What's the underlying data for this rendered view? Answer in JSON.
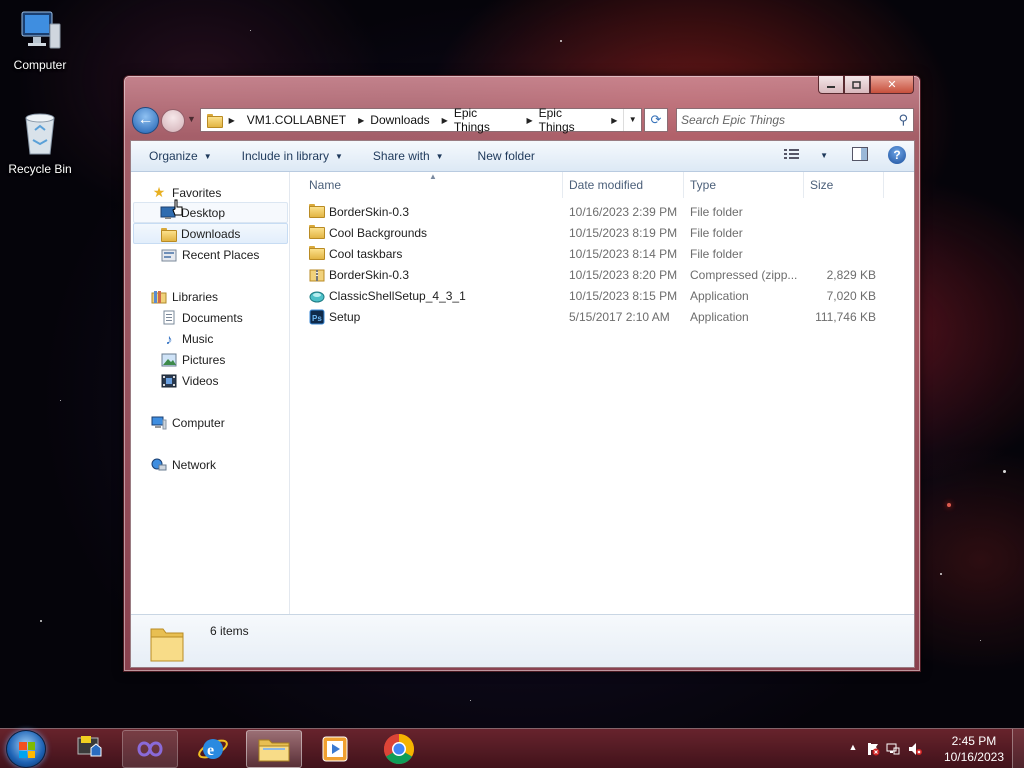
{
  "desktop": {
    "icons": [
      {
        "label": "Computer",
        "icon": "computer-icon"
      },
      {
        "label": "Recycle Bin",
        "icon": "recycle-bin-icon"
      }
    ]
  },
  "window": {
    "caption_buttons": {
      "minimize": "minimize",
      "maximize": "maximize",
      "close": "close"
    },
    "breadcrumb": [
      "VM1.COLLABNET",
      "Downloads",
      "Epic Things",
      "Epic Things"
    ],
    "search_placeholder": "Search Epic Things",
    "toolbar": {
      "organize": "Organize",
      "include_in_library": "Include in library",
      "share_with": "Share with",
      "new_folder": "New folder"
    },
    "nav": {
      "favorites": {
        "label": "Favorites",
        "items": [
          "Desktop",
          "Downloads",
          "Recent Places"
        ]
      },
      "libraries": {
        "label": "Libraries",
        "items": [
          "Documents",
          "Music",
          "Pictures",
          "Videos"
        ]
      },
      "computer": "Computer",
      "network": "Network"
    },
    "columns": {
      "name": "Name",
      "date_modified": "Date modified",
      "type": "Type",
      "size": "Size"
    },
    "files": [
      {
        "name": "BorderSkin-0.3",
        "date": "10/16/2023 2:39 PM",
        "type": "File folder",
        "size": "",
        "icon": "folder-icon"
      },
      {
        "name": "Cool Backgrounds",
        "date": "10/15/2023 8:19 PM",
        "type": "File folder",
        "size": "",
        "icon": "folder-icon"
      },
      {
        "name": "Cool taskbars",
        "date": "10/15/2023 8:14 PM",
        "type": "File folder",
        "size": "",
        "icon": "folder-icon"
      },
      {
        "name": "BorderSkin-0.3",
        "date": "10/15/2023 8:20 PM",
        "type": "Compressed (zipp...",
        "size": "2,829 KB",
        "icon": "zip-folder-icon"
      },
      {
        "name": "ClassicShellSetup_4_3_1",
        "date": "10/15/2023 8:15 PM",
        "type": "Application",
        "size": "7,020 KB",
        "icon": "shell-app-icon"
      },
      {
        "name": "Setup",
        "date": "5/15/2017 2:10 AM",
        "type": "Application",
        "size": "111,746 KB",
        "icon": "photoshop-icon"
      }
    ],
    "details": {
      "count": "6 items"
    }
  },
  "taskbar": {
    "apps": [
      "winstep-icon",
      "infinity-app-icon",
      "internet-explorer-icon",
      "file-explorer-icon",
      "media-player-icon",
      "chrome-icon"
    ],
    "clock": {
      "time": "2:45 PM",
      "date": "10/16/2023"
    }
  },
  "colors": {
    "accent": "#1c4f9c",
    "window_frame": "#c8808c",
    "taskbar": "#5a1a24"
  }
}
